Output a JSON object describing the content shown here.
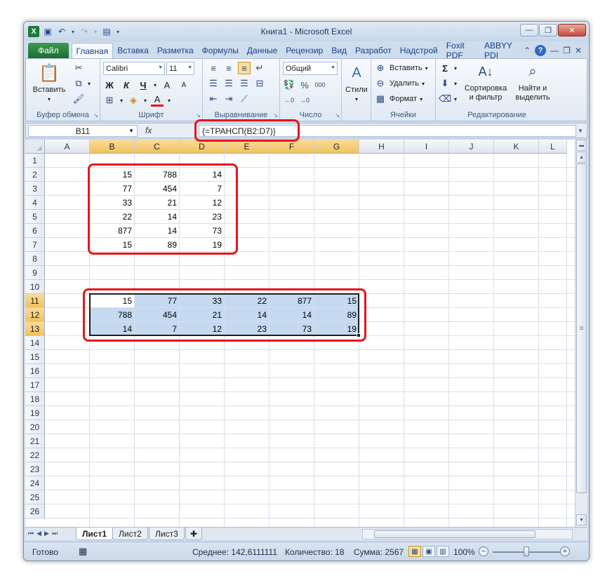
{
  "window": {
    "title": "Книга1 - Microsoft Excel",
    "min_glyph": "—",
    "max_glyph": "❐",
    "close_glyph": "✕",
    "inner_min_glyph": "—",
    "inner_max_glyph": "❐",
    "inner_close_glyph": "✕"
  },
  "ribbon_tabs": [
    {
      "label": "Файл"
    },
    {
      "label": "Главная"
    },
    {
      "label": "Вставка"
    },
    {
      "label": "Разметка"
    },
    {
      "label": "Формулы"
    },
    {
      "label": "Данные"
    },
    {
      "label": "Рецензир"
    },
    {
      "label": "Вид"
    },
    {
      "label": "Разработ"
    },
    {
      "label": "Надстрой"
    },
    {
      "label": "Foxit PDF"
    },
    {
      "label": "ABBYY PDI"
    }
  ],
  "ribbon": {
    "clipboard": {
      "paste_label": "Вставить",
      "group_label": "Буфер обмена"
    },
    "font": {
      "font_name": "Calibri",
      "font_size": "11",
      "bold": "Ж",
      "italic": "К",
      "underline": "Ч",
      "grow": "A",
      "shrink": "A",
      "color_letter": "A",
      "group_label": "Шрифт"
    },
    "alignment": {
      "group_label": "Выравнивание"
    },
    "number": {
      "format": "Общий",
      "percent": "%",
      "comma": "000",
      "group_label": "Число"
    },
    "styles": {
      "label": "Стили"
    },
    "cells": {
      "insert": "Вставить",
      "delete": "Удалить",
      "format": "Формат",
      "group_label": "Ячейки"
    },
    "editing": {
      "sigma": "Σ",
      "sort_label_1": "Сортировка",
      "sort_label_2": "и фильтр",
      "find_label_1": "Найти и",
      "find_label_2": "выделить",
      "group_label": "Редактирование"
    }
  },
  "formula_bar": {
    "name_box": "B11",
    "fx": "fx",
    "formula": "{=ТРАНСП(B2:D7)}"
  },
  "columns": [
    "A",
    "B",
    "C",
    "D",
    "E",
    "F",
    "G",
    "H",
    "I",
    "J",
    "K",
    "L"
  ],
  "rows": [
    "1",
    "2",
    "3",
    "4",
    "5",
    "6",
    "7",
    "8",
    "9",
    "10",
    "11",
    "12",
    "13",
    "14",
    "15",
    "16",
    "17",
    "18",
    "19",
    "20",
    "21",
    "22",
    "23",
    "24",
    "25",
    "26"
  ],
  "source_data": [
    [
      "15",
      "788",
      "14"
    ],
    [
      "77",
      "454",
      "7"
    ],
    [
      "33",
      "21",
      "12"
    ],
    [
      "22",
      "14",
      "23"
    ],
    [
      "877",
      "14",
      "73"
    ],
    [
      "15",
      "89",
      "19"
    ]
  ],
  "transposed_data": [
    [
      "15",
      "77",
      "33",
      "22",
      "877",
      "15"
    ],
    [
      "788",
      "454",
      "21",
      "14",
      "14",
      "89"
    ],
    [
      "14",
      "7",
      "12",
      "23",
      "73",
      "19"
    ]
  ],
  "sheets": [
    {
      "label": "Лист1"
    },
    {
      "label": "Лист2"
    },
    {
      "label": "Лист3"
    }
  ],
  "status": {
    "ready": "Готово",
    "average": "Среднее: 142,6111111",
    "count": "Количество: 18",
    "sum": "Сумма: 2567",
    "zoom": "100%"
  },
  "colors": {
    "selection": "#c5d9f1",
    "header_selected": "#f1c15f",
    "annotation_red": "#e8141b",
    "file_tab": "#1d6e30"
  }
}
